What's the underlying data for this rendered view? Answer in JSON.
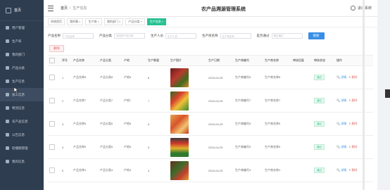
{
  "sidebar": {
    "logo_label": "首页",
    "items": [
      {
        "label": "首页",
        "icon": "home-icon"
      },
      {
        "label": "用户管理",
        "icon": "users-icon"
      },
      {
        "label": "生产商",
        "icon": "factory-icon"
      },
      {
        "label": "我的部门",
        "icon": "dept-icon"
      },
      {
        "label": "产品分类",
        "icon": "category-icon"
      },
      {
        "label": "生产信息",
        "icon": "info-icon"
      },
      {
        "label": "加工信息",
        "icon": "process-icon"
      },
      {
        "label": "物流信息",
        "icon": "truck-icon"
      },
      {
        "label": "农产品信息",
        "icon": "product-icon"
      },
      {
        "label": "公告信息",
        "icon": "notice-icon"
      },
      {
        "label": "轮播图管理",
        "icon": "image-icon"
      },
      {
        "label": "我的信息",
        "icon": "user-icon"
      }
    ],
    "active_index": 6
  },
  "header": {
    "breadcrumb_home": "首页",
    "breadcrumb_current": "生产信息",
    "site_title": "农产品溯源管理系统",
    "logout_label": "退出系统"
  },
  "tags": [
    "系统首页",
    "我的事 ×",
    "生产商 ×",
    "我的部门 ×",
    "产品分类 ×",
    "生产信息 ×"
  ],
  "filter": {
    "product_name_label": "产品名称",
    "product_name_placeholder": "产品名称",
    "product_cat_label": "产品分类",
    "product_cat_placeholder": "请选择产品分类",
    "producer_label": "生产人员",
    "producer_placeholder": "生产人员",
    "prod_name_label": "生产商名称",
    "prod_name_placeholder": "生产商名称",
    "approved_label": "是否通过",
    "approved_placeholder": "是否通过",
    "search_label": "搜索"
  },
  "delete_label": "删除",
  "table": {
    "headers": [
      "序号",
      "产品名称",
      "产品分类",
      "产地",
      "生产数量",
      "生产图片",
      "生产日期",
      "生产商编号",
      "生产商名称",
      "审核回复",
      "审核状态",
      "操作"
    ],
    "rows": [
      {
        "idx": "1",
        "name": "产品名称8",
        "cat": "产品分类8",
        "origin": "产地8",
        "qty": "8",
        "date": "2024-04-25",
        "pno": "生产商编号8",
        "pname": "生产商名称8",
        "reply": "",
        "status": "通过",
        "view": "详情",
        "del": "删除"
      },
      {
        "idx": "2",
        "name": "产品名称7",
        "cat": "产品分类7",
        "origin": "产地7",
        "qty": "7",
        "date": "2024-04-25",
        "pno": "生产商编号7",
        "pname": "生产商名称7",
        "reply": "",
        "status": "通过",
        "view": "详情",
        "del": "删除"
      },
      {
        "idx": "3",
        "name": "产品名称6",
        "cat": "产品分类6",
        "origin": "产地6",
        "qty": "6",
        "date": "2024-04-25",
        "pno": "生产商编号6",
        "pname": "生产商名称6",
        "reply": "",
        "status": "通过",
        "view": "详情",
        "del": "删除"
      },
      {
        "idx": "4",
        "name": "产品名称5",
        "cat": "产品分类5",
        "origin": "产地5",
        "qty": "5",
        "date": "2024-04-25",
        "pno": "生产商编号5",
        "pname": "生产商名称5",
        "reply": "",
        "status": "通过",
        "view": "详情",
        "del": "删除"
      },
      {
        "idx": "5",
        "name": "产品名称4",
        "cat": "产品分类4",
        "origin": "产地4",
        "qty": "4",
        "date": "2024-04-25",
        "pno": "生产商编号4",
        "pname": "生产商名称4",
        "reply": "",
        "status": "通过",
        "view": "详情",
        "del": "删除"
      }
    ]
  },
  "colors": {
    "accent": "#27c192",
    "primary": "#3a8ee6",
    "danger": "#e06b6b",
    "sidebar": "#2f3d50"
  }
}
